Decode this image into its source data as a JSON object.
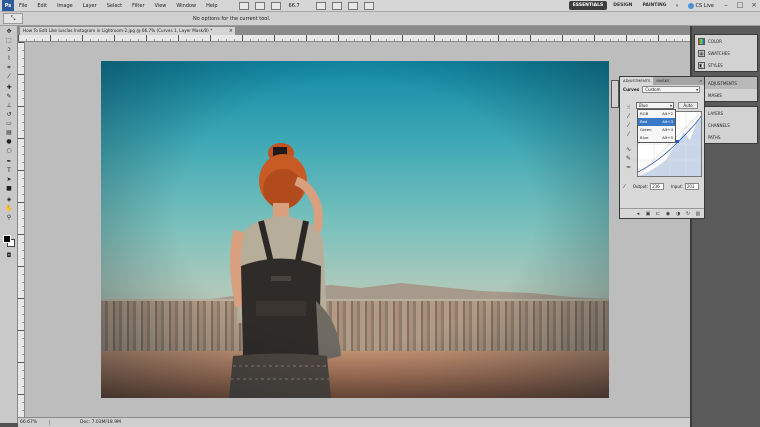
{
  "app": {
    "logo": "Ps"
  },
  "menu": [
    "File",
    "Edit",
    "Image",
    "Layer",
    "Select",
    "Filter",
    "View",
    "Window",
    "Help"
  ],
  "menubar": {
    "zoom": "66.7",
    "workspaces": [
      "ESSENTIALS",
      "DESIGN",
      "PAINTING"
    ],
    "active_workspace": "ESSENTIALS",
    "more": "»",
    "cs_live": "CS Live",
    "win_min": "–",
    "win_max": "□",
    "win_close": "×"
  },
  "options": {
    "message": "No options for the current tool."
  },
  "document": {
    "tab_title": "How To Edit Like Iusclas Instagram in Lightroom-2.jpg @ 66.7% (Curves 1, Layer Mask/8) *",
    "tab_close": "×"
  },
  "status": {
    "zoom": "66.67%",
    "doc_size": "Doc: 7.03M/18.9M"
  },
  "dock_top": [
    {
      "label": "COLOR",
      "icon": "color-icon"
    },
    {
      "label": "SWATCHES",
      "icon": "swatches-icon"
    },
    {
      "label": "STYLES",
      "icon": "styles-icon"
    }
  ],
  "dock_mid": [
    {
      "label": "ADJUSTMENTS",
      "icon": "adjustments-icon",
      "selected": true
    },
    {
      "label": "MASKS",
      "icon": "masks-icon"
    }
  ],
  "dock_bottom": [
    {
      "label": "LAYERS",
      "icon": "layers-icon"
    },
    {
      "label": "CHANNELS",
      "icon": "channels-icon"
    },
    {
      "label": "PATHS",
      "icon": "paths-icon"
    }
  ],
  "adjustments": {
    "tabs": [
      "ADJUSTMENTS",
      "MASKS"
    ],
    "collapse": "»",
    "type_label": "Curves",
    "preset": "Custom",
    "channel": "Blue",
    "auto_label": "Auto",
    "channel_options": [
      {
        "name": "RGB",
        "shortcut": "Alt+2"
      },
      {
        "name": "Red",
        "shortcut": "Alt+3",
        "highlighted": true
      },
      {
        "name": "Green",
        "shortcut": "Alt+4"
      },
      {
        "name": "Blue",
        "shortcut": "Alt+5"
      }
    ],
    "output_label": "Output:",
    "output_value": "236",
    "input_label": "Input:",
    "input_value": "203"
  },
  "colors": {
    "menu_bg": "#d6d6d6",
    "dock_bg": "#5a5a5a",
    "highlight": "#3a78c8",
    "workspace_active": "#3c3c3c"
  }
}
